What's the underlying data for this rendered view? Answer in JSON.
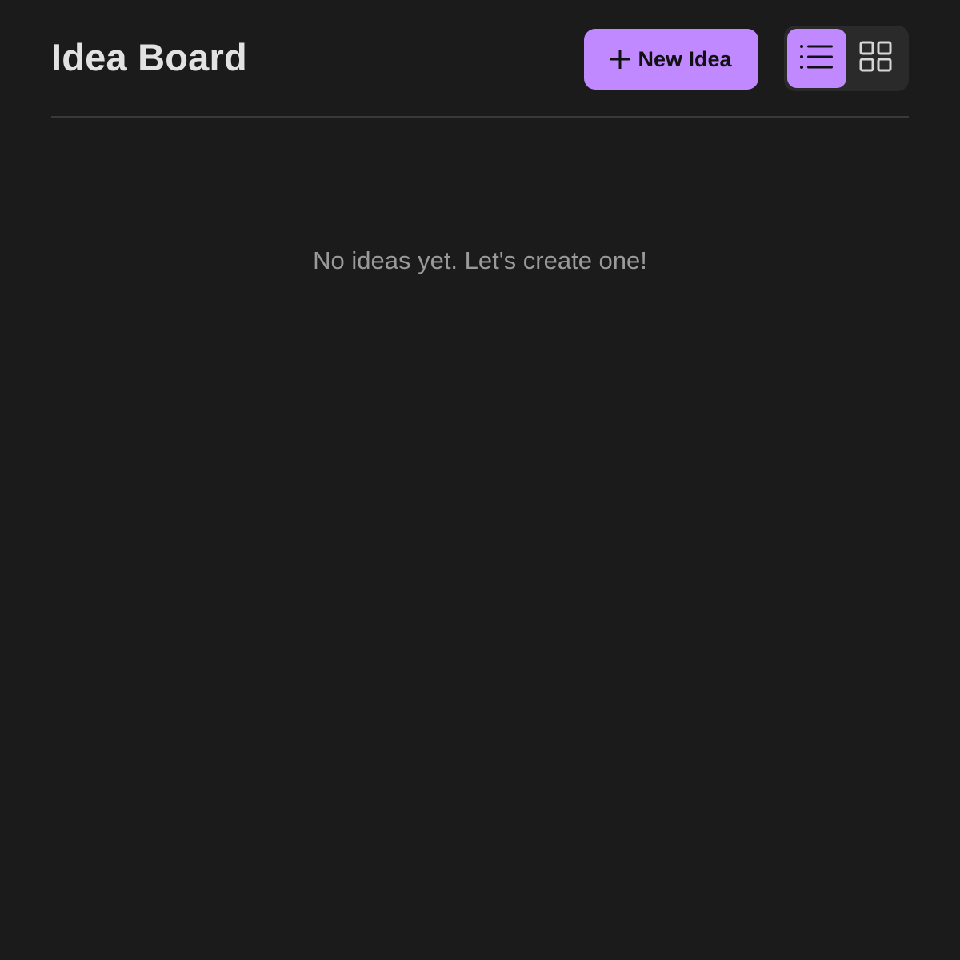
{
  "header": {
    "title": "Idea Board",
    "new_idea_label": "New Idea"
  },
  "view_toggle": {
    "options": [
      {
        "name": "list-view",
        "icon": "list-icon",
        "active": true
      },
      {
        "name": "grid-view",
        "icon": "grid-icon",
        "active": false
      }
    ]
  },
  "main": {
    "empty_message": "No ideas yet. Let's create one!"
  },
  "colors": {
    "background": "#1b1b1b",
    "accent": "#c089ff",
    "title_text": "#e2e2e2",
    "muted_text": "#9a9a9a",
    "toggle_background": "#2a2a2a",
    "divider": "#3a3a3a"
  }
}
